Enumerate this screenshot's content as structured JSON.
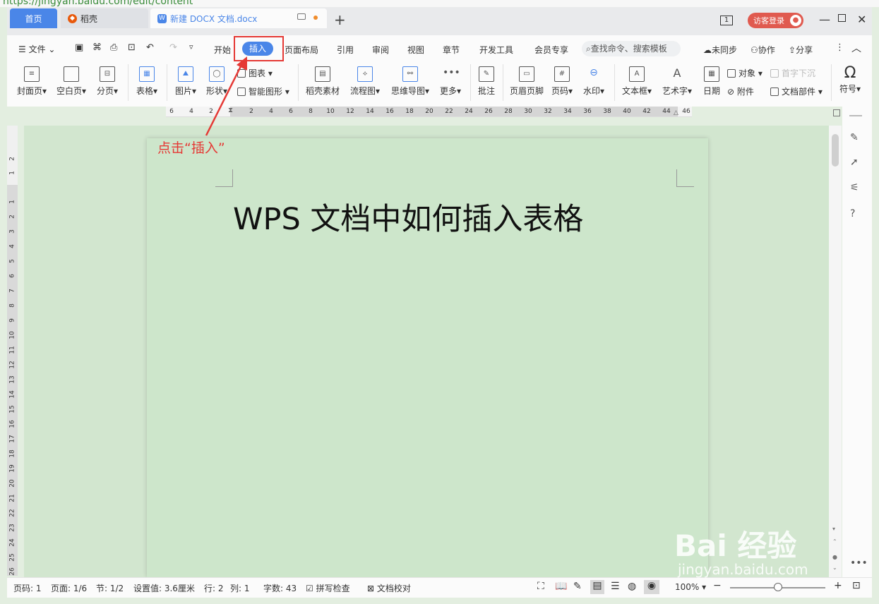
{
  "browser": {
    "url": "https://jingyan.baidu.com/edit/content"
  },
  "tabs": [
    {
      "label": "首页"
    },
    {
      "label": "稻壳"
    },
    {
      "label": "新建 DOCX 文档.docx"
    }
  ],
  "titlebar": {
    "login_label": "访客登录",
    "plus": "+",
    "page_indicator": "1"
  },
  "menu": {
    "file": "文件",
    "items": [
      "开始",
      "插入",
      "页面布局",
      "引用",
      "审阅",
      "视图",
      "章节",
      "开发工具",
      "会员专享"
    ],
    "search_placeholder": "查找命令、搜索模板",
    "sync": "未同步",
    "collab": "协作",
    "share": "分享"
  },
  "ribbon": {
    "cover": "封面页",
    "blank": "空白页",
    "pagebreak": "分页",
    "table": "表格",
    "picture": "图片",
    "shape": "形状",
    "chart": "图表",
    "smartart": "智能图形",
    "assets": "稻壳素材",
    "flowchart": "流程图",
    "mindmap": "思维导图",
    "more": "更多",
    "comment": "批注",
    "headerfooter": "页眉页脚",
    "pagenum": "页码",
    "watermark": "水印",
    "textbox": "文本框",
    "wordart": "艺术字",
    "date": "日期",
    "object": "对象",
    "dropcap": "首字下沉",
    "attachment": "附件",
    "docpart": "文档部件",
    "symbol": "符号"
  },
  "ruler": {
    "h_ticks": [
      "6",
      "4",
      "2",
      "2",
      "4",
      "6",
      "8",
      "10",
      "12",
      "14",
      "16",
      "18",
      "20",
      "22",
      "24",
      "26",
      "28",
      "30",
      "32",
      "34",
      "36",
      "38",
      "40",
      "42",
      "44",
      "46"
    ],
    "v_ticks": [
      "2",
      "1",
      "1",
      "2",
      "3",
      "4",
      "5",
      "6",
      "7",
      "8",
      "9",
      "10",
      "11",
      "12",
      "13",
      "14",
      "15",
      "16",
      "17",
      "18",
      "19",
      "20",
      "21",
      "22",
      "23",
      "24",
      "25",
      "26"
    ]
  },
  "document": {
    "title": "WPS 文档中如何插入表格"
  },
  "annotation": {
    "text": "点击“插入”"
  },
  "status": {
    "pagecode": "页码: 1",
    "page": "页面: 1/6",
    "section": "节: 1/2",
    "setting": "设置值: 3.6厘米",
    "row": "行: 2",
    "col": "列: 1",
    "words": "字数: 43",
    "spellcheck": "拼写检查",
    "proof": "文档校对",
    "zoom": "100%"
  },
  "watermark": {
    "brand": "Bai 经验",
    "url": "jingyan.baidu.com"
  },
  "colors": {
    "accent": "#4a86e8",
    "annotation": "#e53935",
    "page": "#cde6cb"
  }
}
